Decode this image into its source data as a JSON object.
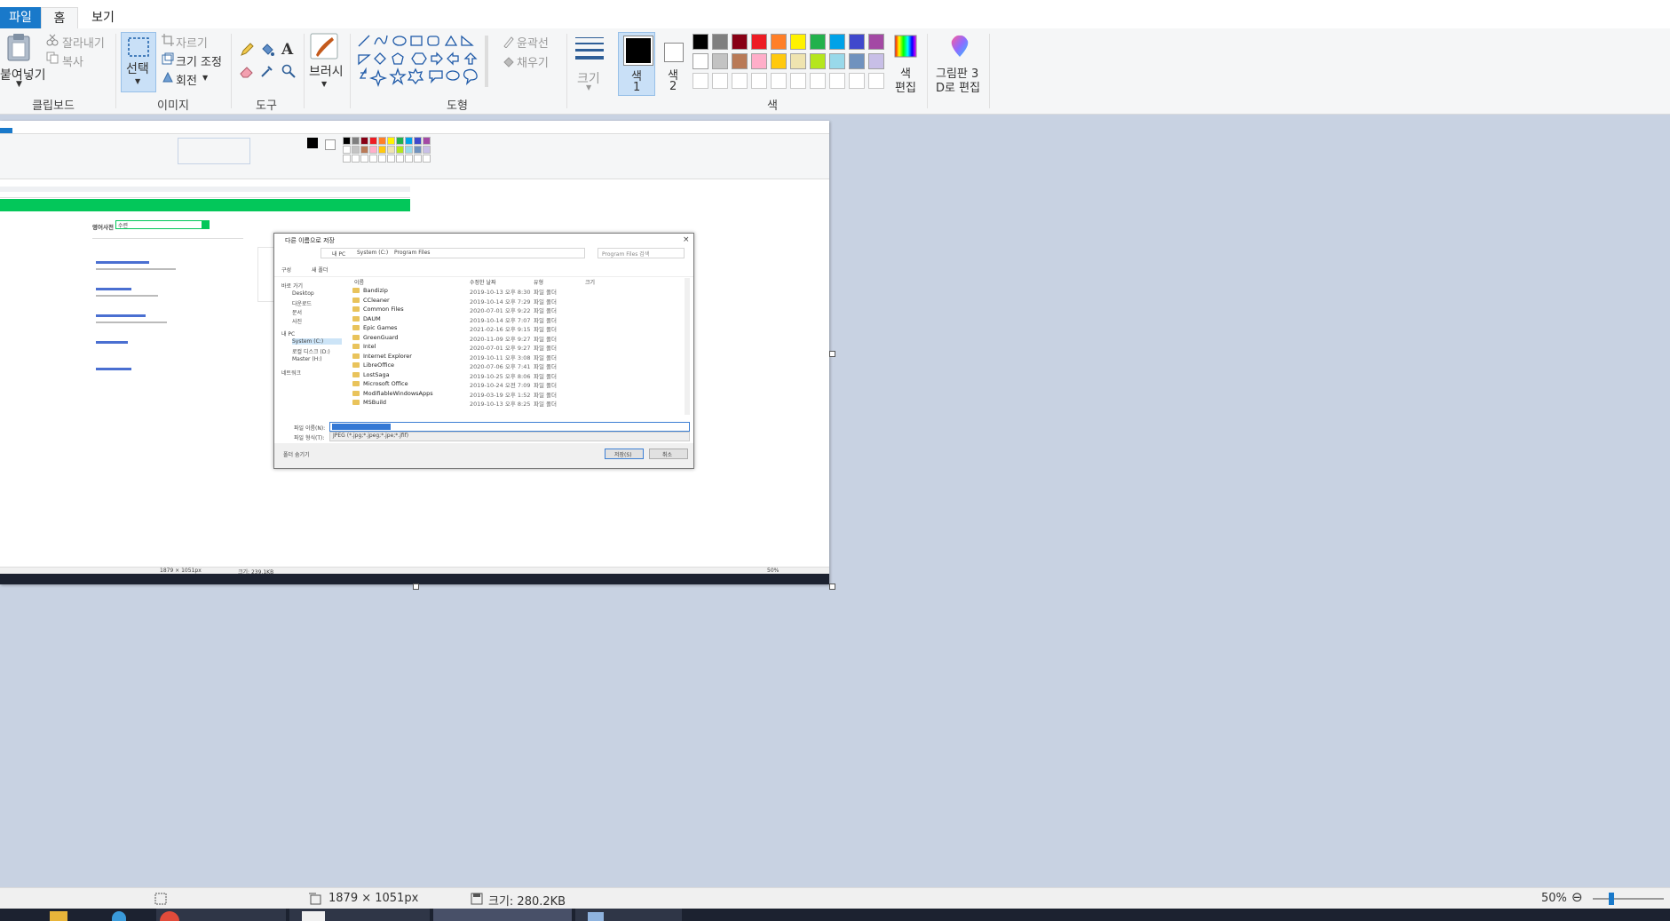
{
  "tabs": {
    "file": "파일",
    "home": "홈",
    "view": "보기"
  },
  "ribbon": {
    "clipboard": {
      "paste": "붙여넣기",
      "cut": "잘라내기",
      "copy": "복사",
      "label": "클립보드"
    },
    "image": {
      "select": "선택",
      "crop": "자르기",
      "resize": "크기 조정",
      "rotate": "회전",
      "label": "이미지"
    },
    "tools": {
      "label": "도구"
    },
    "brush": {
      "label": "브러시"
    },
    "shapes": {
      "outline": "윤곽선",
      "fill": "채우기",
      "label": "도형"
    },
    "size": {
      "label": "크기"
    },
    "color1": {
      "line1": "색",
      "line2": "1"
    },
    "color2": {
      "line1": "색",
      "line2": "2"
    },
    "palette": {
      "row1": [
        "#000000",
        "#7f7f7f",
        "#880015",
        "#ed1c24",
        "#ff7f27",
        "#fff200",
        "#22b14c",
        "#00a2e8",
        "#3f48cc",
        "#a349a4"
      ],
      "row2": [
        "#ffffff",
        "#c3c3c3",
        "#b97a57",
        "#ffaec9",
        "#ffc90e",
        "#efe4b0",
        "#b5e61d",
        "#99d9ea",
        "#7092be",
        "#c8bfe7"
      ],
      "row3": [
        "#ffffff",
        "#ffffff",
        "#ffffff",
        "#ffffff",
        "#ffffff",
        "#ffffff",
        "#ffffff",
        "#ffffff",
        "#ffffff",
        "#ffffff"
      ],
      "label": "색"
    },
    "edit_colors": {
      "line1": "색",
      "line2": "편집"
    },
    "paint3d": {
      "line1": "그림판 3",
      "line2": "D로 편집"
    }
  },
  "status": {
    "dimensions": "1879 × 1051px",
    "size": "크기: 280.2KB",
    "zoom": "50%"
  },
  "inner": {
    "dialog": {
      "title": "다른 이름으로 저장",
      "path": [
        "내 PC",
        "System (C:)",
        "Program Files"
      ],
      "search_placeholder": "Program Files 검색",
      "organize": "구성",
      "new_folder": "새 폴더",
      "nav": [
        "바로 가기",
        "Desktop",
        "다운로드",
        "문서",
        "사진",
        "내 PC",
        "System (C:)",
        "로컬 디스크 (D:)",
        "Master (H:)",
        "네트워크"
      ],
      "columns": [
        "이름",
        "수정한 날짜",
        "유형",
        "크기"
      ],
      "files": [
        {
          "name": "Bandizip",
          "date": "2019-10-13 오후 8:30",
          "type": "파일 폴더"
        },
        {
          "name": "CCleaner",
          "date": "2019-10-14 오후 7:29",
          "type": "파일 폴더"
        },
        {
          "name": "Common Files",
          "date": "2020-07-01 오후 9:22",
          "type": "파일 폴더"
        },
        {
          "name": "DAUM",
          "date": "2019-10-14 오후 7:07",
          "type": "파일 폴더"
        },
        {
          "name": "Epic Games",
          "date": "2021-02-16 오후 9:15",
          "type": "파일 폴더"
        },
        {
          "name": "GreenGuard",
          "date": "2020-11-09 오후 9:27",
          "type": "파일 폴더"
        },
        {
          "name": "Intel",
          "date": "2020-07-01 오후 9:27",
          "type": "파일 폴더"
        },
        {
          "name": "Internet Explorer",
          "date": "2019-10-11 오후 3:08",
          "type": "파일 폴더"
        },
        {
          "name": "LibreOffice",
          "date": "2020-07-06 오후 7:41",
          "type": "파일 폴더"
        },
        {
          "name": "LostSaga",
          "date": "2019-10-25 오후 8:06",
          "type": "파일 폴더"
        },
        {
          "name": "Microsoft Office",
          "date": "2019-10-24 오전 7:09",
          "type": "파일 폴더"
        },
        {
          "name": "ModifiableWindowsApps",
          "date": "2019-03-19 오후 1:52",
          "type": "파일 폴더"
        },
        {
          "name": "MSBuild",
          "date": "2019-10-13 오후 8:25",
          "type": "파일 폴더"
        }
      ],
      "filename_label": "파일 이름(N):",
      "filetype_label": "파일 형식(T):",
      "filetype_value": "JPEG (*.jpg;*.jpeg;*.jpe;*.jfif)",
      "hide_folders": "폴더 숨기기",
      "save": "저장(S)",
      "cancel": "취소"
    },
    "dict_title": "영어사전",
    "dict_query": "수련",
    "status_dimensions": "1879 × 1051px",
    "status_size": "크기: 239.1KB",
    "status_zoom": "50%"
  }
}
